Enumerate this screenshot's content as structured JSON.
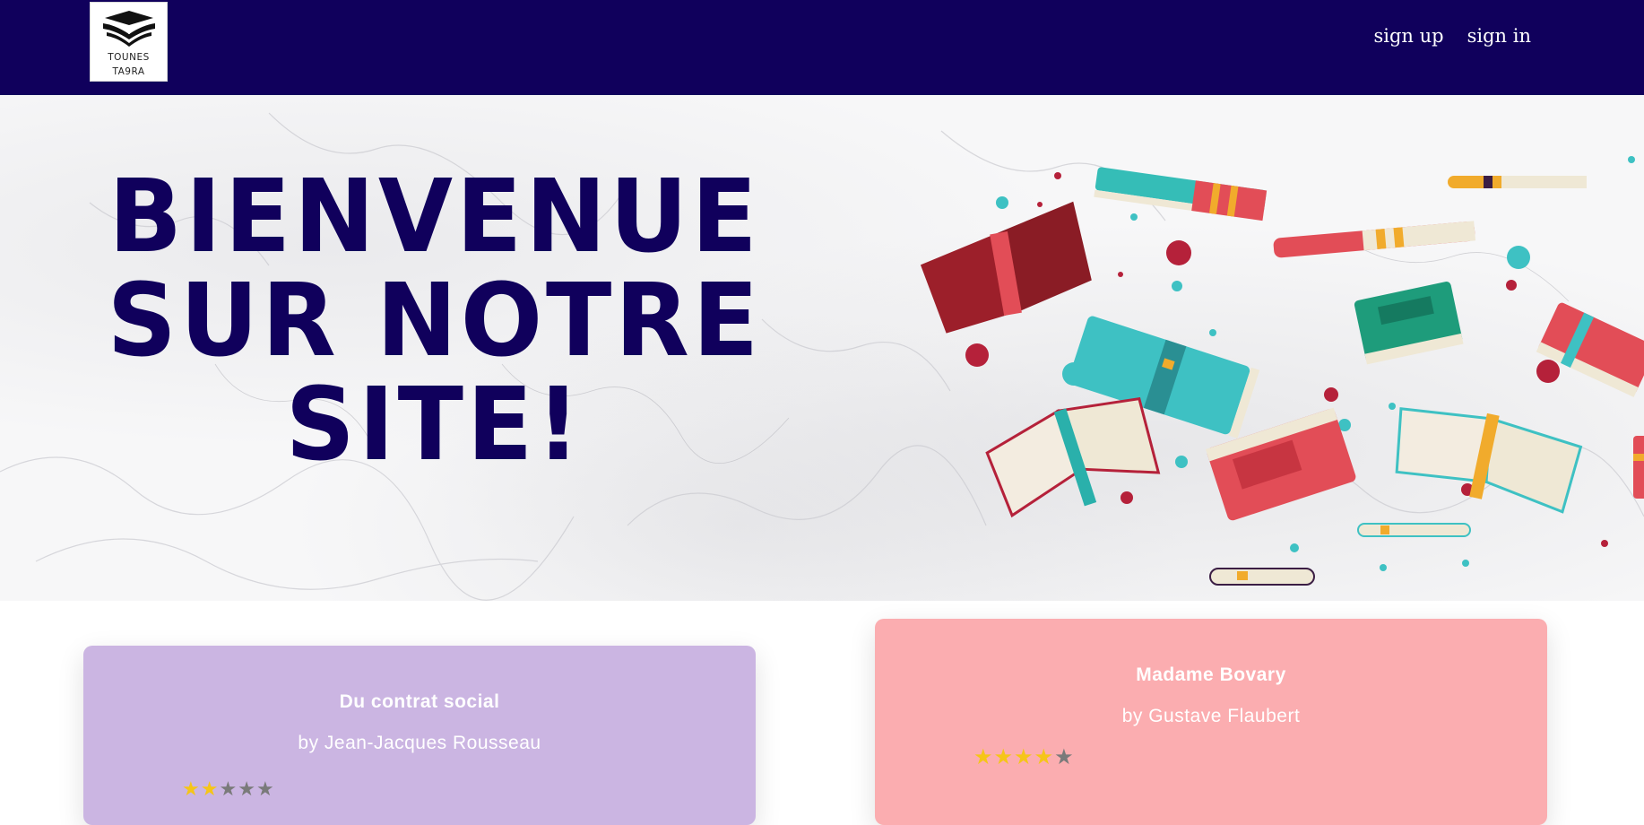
{
  "header": {
    "logo_line1": "TOUNES",
    "logo_line2": "TA9RA",
    "nav": {
      "signup_label": "sign up",
      "signin_label": "sign in"
    },
    "bg_color": "#10005c"
  },
  "hero": {
    "title_line1": "BIENVENUE",
    "title_line2": "SUR NOTRE",
    "title_line3": "SITE!",
    "title_color": "#10005c"
  },
  "cards": [
    {
      "title": "Du contrat social",
      "author": "by Jean-Jacques Rousseau",
      "rating": 2,
      "max_rating": 5,
      "bg_color": "#cbb5e2"
    },
    {
      "title": "Madame Bovary",
      "author": "by Gustave Flaubert",
      "rating": 4,
      "max_rating": 5,
      "bg_color": "#fbadb0"
    }
  ],
  "colors": {
    "star_filled": "#f5c518",
    "star_empty": "#7a7a7a"
  },
  "icons": {
    "logo": "open-book-logo-icon",
    "star": "star-icon"
  }
}
